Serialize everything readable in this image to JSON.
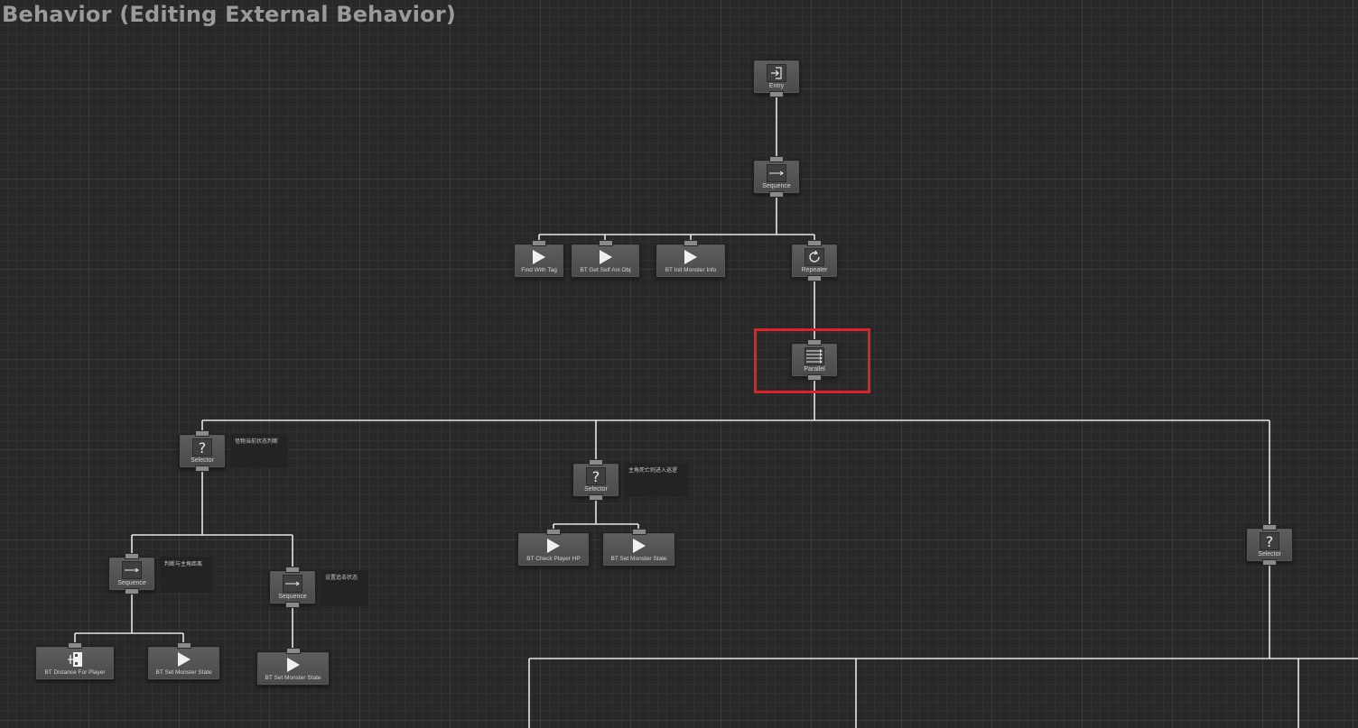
{
  "window": {
    "title": "Behavior (Editing External Behavior)"
  },
  "colors": {
    "background": "#282828",
    "link": "#e6e6e6",
    "node": "#555555",
    "highlight": "#e0212a"
  },
  "tree": {
    "entry": {
      "label": "Entry",
      "icon": "entry-icon"
    },
    "root_sequence": {
      "label": "Sequence",
      "icon": "sequence-icon"
    },
    "find_with_tag": {
      "label": "Find With Tag",
      "icon": "play-icon"
    },
    "get_self_ani_obj": {
      "label": "BT   Get Self Ani Obj",
      "icon": "play-icon"
    },
    "init_monster_info": {
      "label": "BT   Init Monster Info",
      "icon": "play-icon"
    },
    "repeater": {
      "label": "Repeater",
      "icon": "repeat-icon"
    },
    "parallel": {
      "label": "Parallel",
      "icon": "parallel-icon",
      "selected": true
    },
    "selector_left": {
      "label": "Selector",
      "icon": "question-icon",
      "comment": "怪物当前状态判断"
    },
    "selector_mid": {
      "label": "Selector",
      "icon": "question-icon",
      "comment": "主角死亡则进入巡逻"
    },
    "selector_right": {
      "label": "Selector",
      "icon": "question-icon"
    },
    "sequence_a": {
      "label": "Sequence",
      "icon": "sequence-icon",
      "comment": "判断与主角距离"
    },
    "sequence_b": {
      "label": "Sequence",
      "icon": "sequence-icon",
      "comment": "设置追击状态"
    },
    "check_player_hp": {
      "label": "BT   Check Player HP",
      "icon": "play-icon"
    },
    "set_monster_state_mid": {
      "label": "BT   Set Monster State",
      "icon": "play-icon"
    },
    "distance_for_player": {
      "label": "BT   Distance For Player",
      "icon": "distance-icon"
    },
    "set_monster_state_a": {
      "label": "BT   Set Monster State",
      "icon": "play-icon"
    },
    "set_monster_state_b": {
      "label": "BT   Set Monster State",
      "icon": "play-icon"
    }
  }
}
